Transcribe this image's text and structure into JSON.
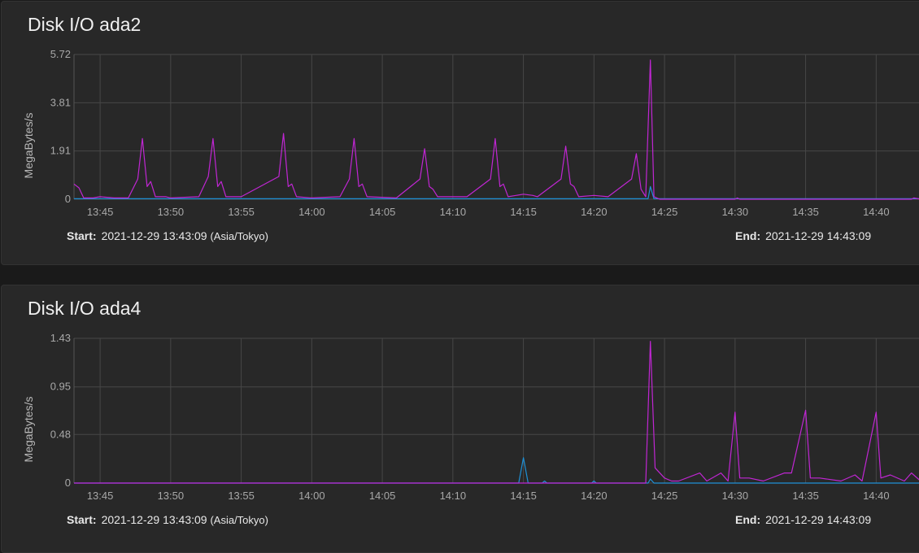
{
  "panels": [
    {
      "title": "Disk I/O ada2",
      "start_label": "Start:",
      "start_value": "2021-12-29 13:43:09",
      "timezone": "(Asia/Tokyo)",
      "end_label": "End:",
      "end_value": "2021-12-29 14:43:09"
    },
    {
      "title": "Disk I/O ada4",
      "start_label": "Start:",
      "start_value": "2021-12-29 13:43:09",
      "timezone": "(Asia/Tokyo)",
      "end_label": "End:",
      "end_value": "2021-12-29 14:43:09"
    }
  ],
  "chart_data": [
    {
      "type": "line",
      "title": "Disk I/O ada2",
      "ylabel": "MegaBytes/s",
      "ylim": [
        0,
        5.72
      ],
      "yticks": [
        "0",
        "1.91",
        "3.81",
        "5.72"
      ],
      "xlim": [
        "13:43:09",
        "14:43:09"
      ],
      "xticks": [
        "13:45",
        "13:50",
        "13:55",
        "14:00",
        "14:05",
        "14:10",
        "14:15",
        "14:20",
        "14:25",
        "14:30",
        "14:35",
        "14:40"
      ],
      "grid": true,
      "series": [
        {
          "color": "#c026d3",
          "points": [
            [
              "13:43:09",
              0.6
            ],
            [
              "13:43:30",
              0.45
            ],
            [
              "13:43:50",
              0.05
            ],
            [
              "13:44:30",
              0.05
            ],
            [
              "13:45:00",
              0.1
            ],
            [
              "13:46:00",
              0.05
            ],
            [
              "13:47:00",
              0.05
            ],
            [
              "13:47:40",
              0.8
            ],
            [
              "13:48:00",
              2.4
            ],
            [
              "13:48:20",
              0.5
            ],
            [
              "13:48:35",
              0.7
            ],
            [
              "13:48:55",
              0.1
            ],
            [
              "13:49:40",
              0.1
            ],
            [
              "13:50:00",
              0.05
            ],
            [
              "13:52:00",
              0.1
            ],
            [
              "13:52:40",
              0.9
            ],
            [
              "13:53:00",
              2.4
            ],
            [
              "13:53:20",
              0.5
            ],
            [
              "13:53:35",
              0.7
            ],
            [
              "13:53:55",
              0.1
            ],
            [
              "13:55:00",
              0.1
            ],
            [
              "13:57:40",
              0.9
            ],
            [
              "13:58:00",
              2.6
            ],
            [
              "13:58:20",
              0.5
            ],
            [
              "13:58:35",
              0.6
            ],
            [
              "13:58:55",
              0.1
            ],
            [
              "14:00:00",
              0.05
            ],
            [
              "14:02:00",
              0.1
            ],
            [
              "14:02:40",
              0.8
            ],
            [
              "14:03:00",
              2.4
            ],
            [
              "14:03:20",
              0.5
            ],
            [
              "14:03:35",
              0.6
            ],
            [
              "14:03:55",
              0.1
            ],
            [
              "14:06:00",
              0.05
            ],
            [
              "14:07:40",
              0.8
            ],
            [
              "14:08:00",
              2.0
            ],
            [
              "14:08:20",
              0.5
            ],
            [
              "14:08:35",
              0.4
            ],
            [
              "14:08:55",
              0.1
            ],
            [
              "14:11:00",
              0.1
            ],
            [
              "14:12:40",
              0.8
            ],
            [
              "14:13:00",
              2.4
            ],
            [
              "14:13:20",
              0.5
            ],
            [
              "14:13:35",
              0.6
            ],
            [
              "14:13:55",
              0.1
            ],
            [
              "14:15:00",
              0.2
            ],
            [
              "14:15:40",
              0.15
            ],
            [
              "14:16:00",
              0.1
            ],
            [
              "14:17:40",
              0.8
            ],
            [
              "14:18:00",
              2.1
            ],
            [
              "14:18:20",
              0.6
            ],
            [
              "14:18:35",
              0.5
            ],
            [
              "14:18:55",
              0.1
            ],
            [
              "14:20:00",
              0.15
            ],
            [
              "14:21:00",
              0.1
            ],
            [
              "14:22:40",
              0.8
            ],
            [
              "14:23:00",
              1.8
            ],
            [
              "14:23:20",
              0.4
            ],
            [
              "14:23:40",
              0.1
            ],
            [
              "14:24:00",
              5.5
            ],
            [
              "14:24:15",
              0.1
            ],
            [
              "14:24:40",
              0.0
            ],
            [
              "14:30:00",
              0.0
            ],
            [
              "14:30:10",
              0.05
            ],
            [
              "14:30:20",
              0.0
            ],
            [
              "14:42:30",
              0.0
            ],
            [
              "14:42:40",
              0.05
            ],
            [
              "14:43:09",
              0.0
            ]
          ]
        },
        {
          "color": "#1e90d6",
          "points": [
            [
              "13:43:09",
              0.02
            ],
            [
              "14:23:50",
              0.02
            ],
            [
              "14:24:00",
              0.5
            ],
            [
              "14:24:15",
              0.02
            ],
            [
              "14:43:09",
              0.02
            ]
          ]
        }
      ]
    },
    {
      "type": "line",
      "title": "Disk I/O ada4",
      "ylabel": "MegaBytes/s",
      "ylim": [
        0,
        1.43
      ],
      "yticks": [
        "0",
        "0.48",
        "0.95",
        "1.43"
      ],
      "xlim": [
        "13:43:09",
        "14:43:09"
      ],
      "xticks": [
        "13:45",
        "13:50",
        "13:55",
        "14:00",
        "14:05",
        "14:10",
        "14:15",
        "14:20",
        "14:25",
        "14:30",
        "14:35",
        "14:40"
      ],
      "grid": true,
      "series": [
        {
          "color": "#c026d3",
          "points": [
            [
              "13:43:09",
              0.0
            ],
            [
              "14:23:40",
              0.0
            ],
            [
              "14:24:00",
              1.4
            ],
            [
              "14:24:20",
              0.15
            ],
            [
              "14:25:00",
              0.05
            ],
            [
              "14:25:30",
              0.02
            ],
            [
              "14:26:00",
              0.02
            ],
            [
              "14:27:30",
              0.1
            ],
            [
              "14:28:00",
              0.02
            ],
            [
              "14:29:00",
              0.1
            ],
            [
              "14:29:30",
              0.02
            ],
            [
              "14:30:00",
              0.7
            ],
            [
              "14:30:20",
              0.05
            ],
            [
              "14:31:00",
              0.05
            ],
            [
              "14:32:00",
              0.02
            ],
            [
              "14:33:30",
              0.1
            ],
            [
              "14:34:00",
              0.1
            ],
            [
              "14:35:00",
              0.72
            ],
            [
              "14:35:20",
              0.05
            ],
            [
              "14:36:00",
              0.05
            ],
            [
              "14:37:30",
              0.02
            ],
            [
              "14:38:30",
              0.08
            ],
            [
              "14:39:00",
              0.02
            ],
            [
              "14:40:00",
              0.7
            ],
            [
              "14:40:20",
              0.05
            ],
            [
              "14:41:00",
              0.08
            ],
            [
              "14:42:00",
              0.02
            ],
            [
              "14:42:30",
              0.1
            ],
            [
              "14:43:09",
              0.02
            ]
          ]
        },
        {
          "color": "#1e90d6",
          "points": [
            [
              "13:43:09",
              0.0
            ],
            [
              "14:14:40",
              0.0
            ],
            [
              "14:15:00",
              0.25
            ],
            [
              "14:15:20",
              0.0
            ],
            [
              "14:16:20",
              0.0
            ],
            [
              "14:16:30",
              0.02
            ],
            [
              "14:16:40",
              0.0
            ],
            [
              "14:19:50",
              0.0
            ],
            [
              "14:20:00",
              0.02
            ],
            [
              "14:20:10",
              0.0
            ],
            [
              "14:23:50",
              0.0
            ],
            [
              "14:24:00",
              0.04
            ],
            [
              "14:24:15",
              0.0
            ],
            [
              "14:43:09",
              0.0
            ]
          ]
        }
      ]
    }
  ]
}
